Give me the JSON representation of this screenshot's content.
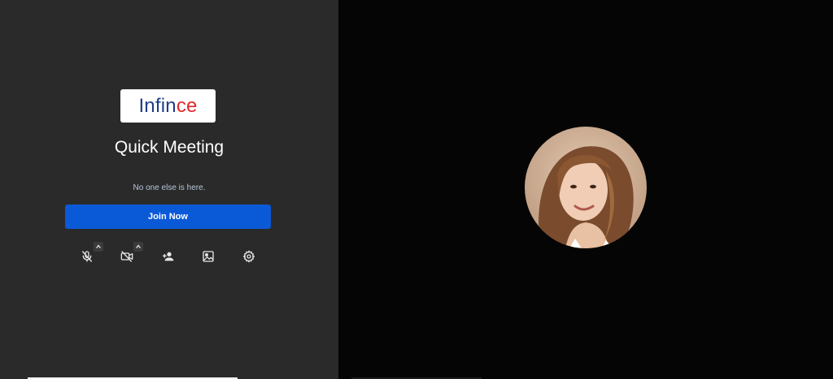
{
  "brand": {
    "logo_part1": "Infin",
    "logo_part2": "ce"
  },
  "meeting": {
    "title": "Quick Meeting",
    "status": "No one else is here.",
    "join_label": "Join Now"
  },
  "controls": {
    "mic": {
      "icon": "mic-off-icon",
      "state": "muted"
    },
    "camera": {
      "icon": "camera-off-icon",
      "state": "off"
    },
    "invite": {
      "icon": "add-person-icon"
    },
    "background": {
      "icon": "image-icon"
    },
    "settings": {
      "icon": "gear-icon"
    }
  },
  "colors": {
    "left_panel": "#2a2a2a",
    "right_panel": "#050505",
    "join_button": "#0a5ad8",
    "logo_blue": "#1f3c88",
    "logo_red": "#e0282b"
  }
}
